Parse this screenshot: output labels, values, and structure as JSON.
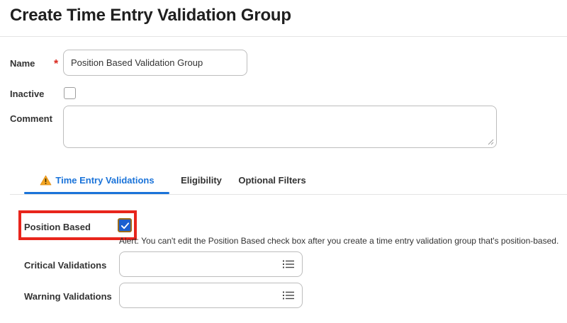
{
  "header": {
    "title": "Create Time Entry Validation Group"
  },
  "form": {
    "name_label": "Name",
    "required_marker": "*",
    "name_value": "Position Based Validation Group",
    "inactive_label": "Inactive",
    "inactive_checked": false,
    "comment_label": "Comment",
    "comment_value": ""
  },
  "tabs": [
    {
      "label": "Time Entry Validations",
      "active": true,
      "icon": "warning-icon"
    },
    {
      "label": "Eligibility",
      "active": false
    },
    {
      "label": "Optional Filters",
      "active": false
    }
  ],
  "validations": {
    "position_based_label": "Position Based",
    "position_based_checked": true,
    "alert_text": "Alert: You can't edit the Position Based check box after you create a time entry validation group that's position-based.",
    "critical_label": "Critical Validations",
    "warning_label": "Warning Validations",
    "prompt_icon": "list-icon"
  },
  "colors": {
    "accent": "#1a73d9",
    "highlight": "#e8251c",
    "required": "#d9261c",
    "warning": "#f5a623",
    "checkbox_fill": "#1a5fd0"
  }
}
